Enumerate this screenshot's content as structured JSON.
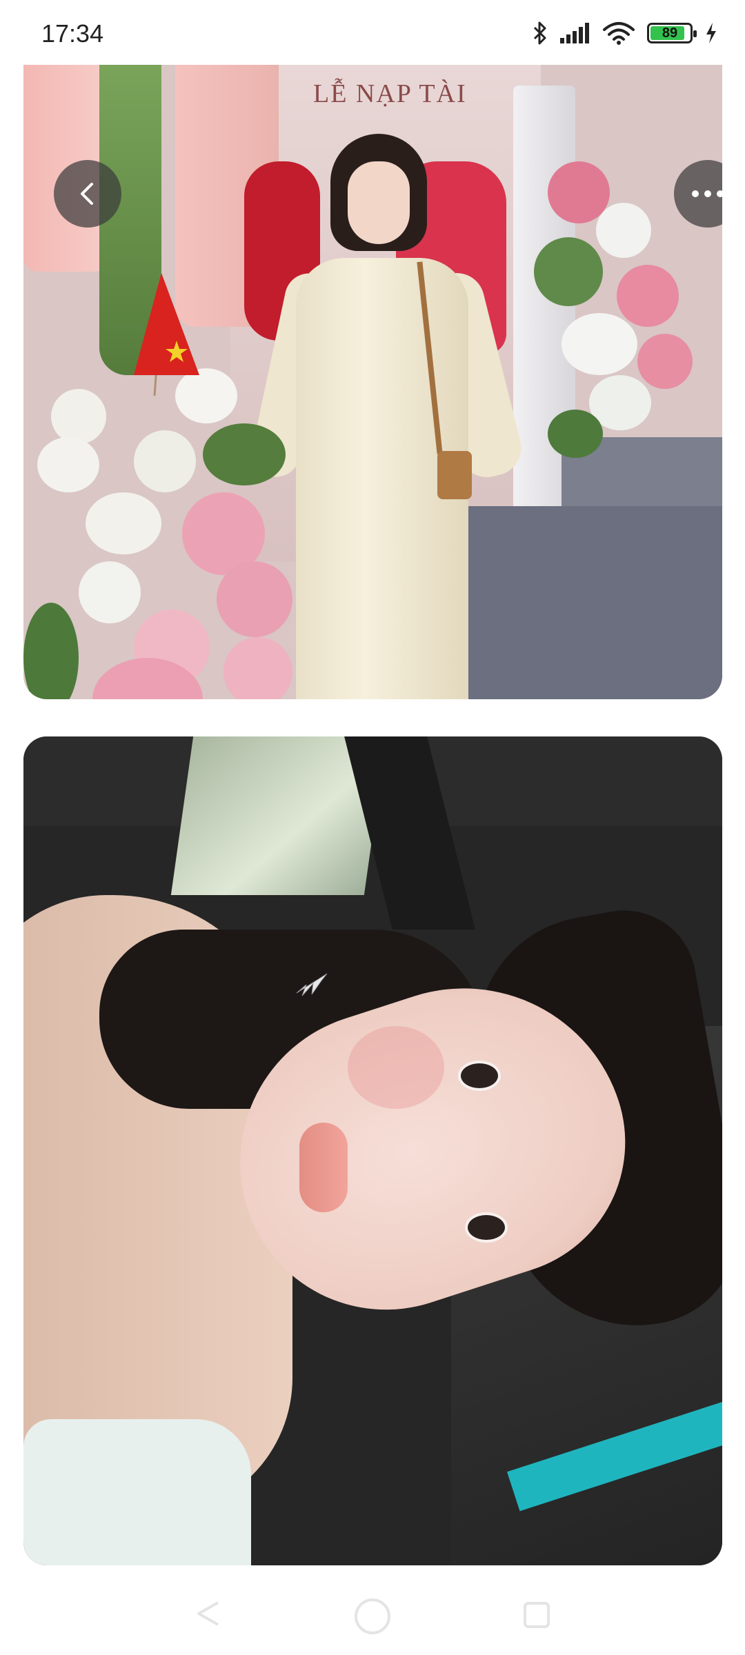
{
  "status_bar": {
    "time": "17:34",
    "icons": [
      "bluetooth-icon",
      "signal-icon",
      "wifi-icon",
      "battery-icon",
      "charging-icon"
    ],
    "battery_level": 89,
    "battery_text": "89",
    "battery_color": "#33c24d"
  },
  "photo1": {
    "sign_text": "LỄ NẠP TÀI"
  },
  "overlay_buttons": {
    "back_icon": "chevron-left-icon",
    "more_icon": "more-horizontal-icon"
  },
  "nav_bar": {
    "icons": [
      "nav-back-icon",
      "nav-home-icon",
      "nav-recent-icon"
    ]
  }
}
